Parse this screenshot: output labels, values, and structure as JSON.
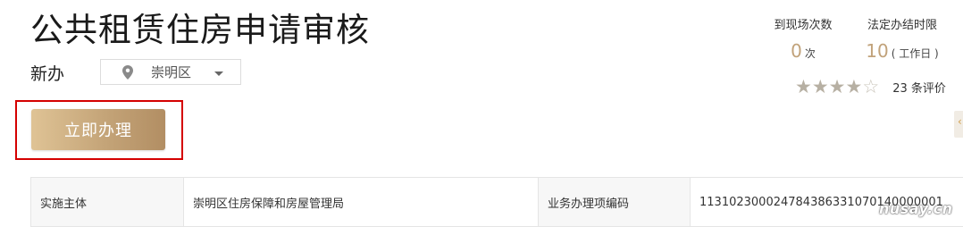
{
  "header": {
    "title": "公共租赁住房申请审核",
    "service_type": "新办"
  },
  "district_select": {
    "icon": "location-pin-icon",
    "value": "崇明区"
  },
  "stats": {
    "visits_label": "到现场次数",
    "visits_value": "0",
    "visits_unit": "次",
    "limit_label": "法定办结时限",
    "limit_value": "10",
    "limit_unit": "( 工作日 )"
  },
  "rating": {
    "stars_filled": 4,
    "stars_total": 5,
    "count_text": "23 条评价"
  },
  "actions": {
    "apply_label": "立即办理"
  },
  "side_tab": {
    "glyph": "‹"
  },
  "info_table": {
    "rows": [
      {
        "key1": "实施主体",
        "value1": "崇明区住房保障和房屋管理局",
        "key2": "业务办理项编码",
        "value2": "113102300024784386331070140000001"
      }
    ]
  },
  "watermark": "nusay.cn",
  "colors": {
    "accent_gold": "#c1a27a",
    "button_gradient_start": "#dfc395",
    "button_gradient_end": "#b28e63",
    "highlight_red": "#d40000"
  }
}
